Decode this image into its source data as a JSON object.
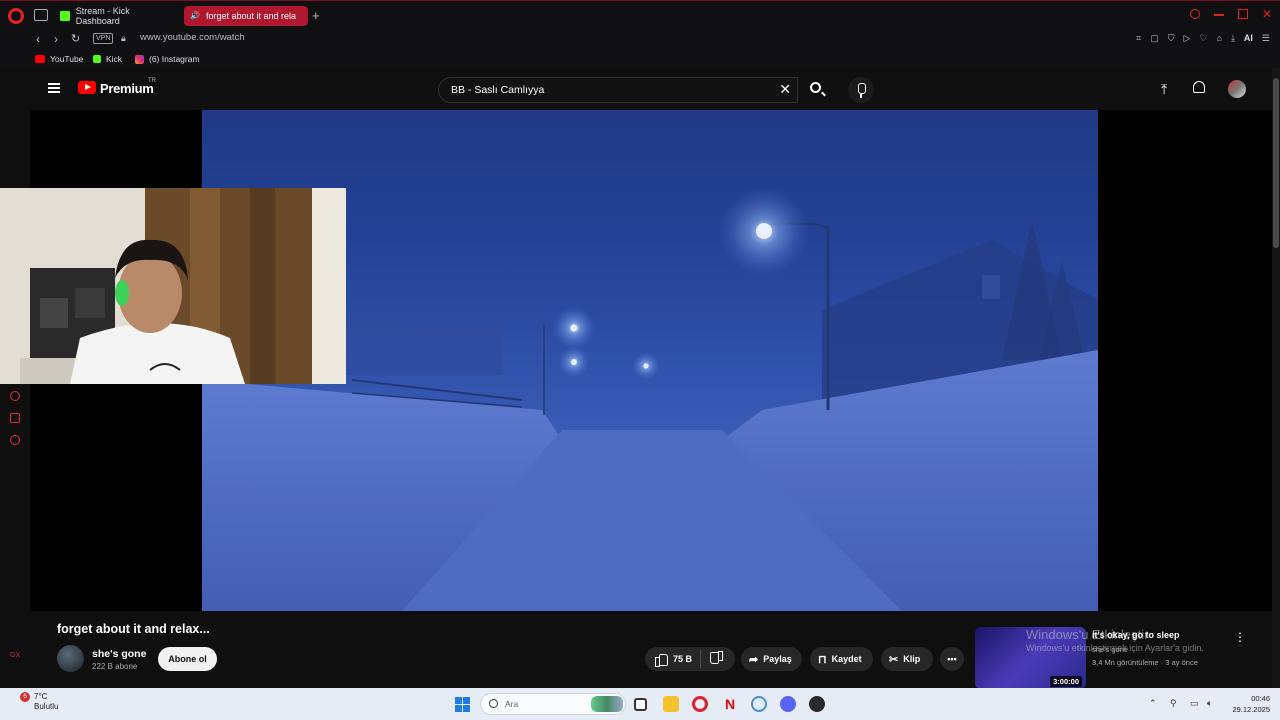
{
  "browser": {
    "tabs": [
      {
        "label": "Stream - Kick Dashboard",
        "active": false
      },
      {
        "label": "forget about it and rela",
        "active": true
      }
    ],
    "url": "www.youtube.com/watch",
    "vpn_label": "VPN",
    "ai_label": "AI",
    "bookmarks": [
      {
        "label": "YouTube"
      },
      {
        "label": "Kick"
      },
      {
        "label": "(6) Instagram"
      }
    ]
  },
  "youtube": {
    "brand": "Premium",
    "country": "TR",
    "search_value": "BB - Saslı Camlıyya"
  },
  "video": {
    "title": "forget about it and relax...",
    "channel_name": "she's gone",
    "subscribers": "222 B abone",
    "subscribe_label": "Abone ol",
    "likes": "75 B",
    "share_label": "Paylaş",
    "save_label": "Kaydet",
    "clip_label": "Klip",
    "more_label": "•••"
  },
  "recommended": {
    "title": "it's okay, go to sleep",
    "channel": "she's gone",
    "meta": "3,4 Mn görüntüleme · 3 ay önce",
    "duration": "3:00:00"
  },
  "windows_watermark": {
    "line1": "Windows'u Etkinleştir",
    "line2": "Windows'u etkinleştirmek için Ayarlar'a gidin."
  },
  "taskbar": {
    "weather_temp": "7°C",
    "weather_desc": "Bulutlu",
    "weather_badge": "6",
    "search_placeholder": "Ara",
    "time": "00:46",
    "date": "29.12.2025"
  },
  "colors": {
    "accent_red": "#b0162e",
    "youtube_red": "#ff0000",
    "kick_green": "#53fc18"
  }
}
